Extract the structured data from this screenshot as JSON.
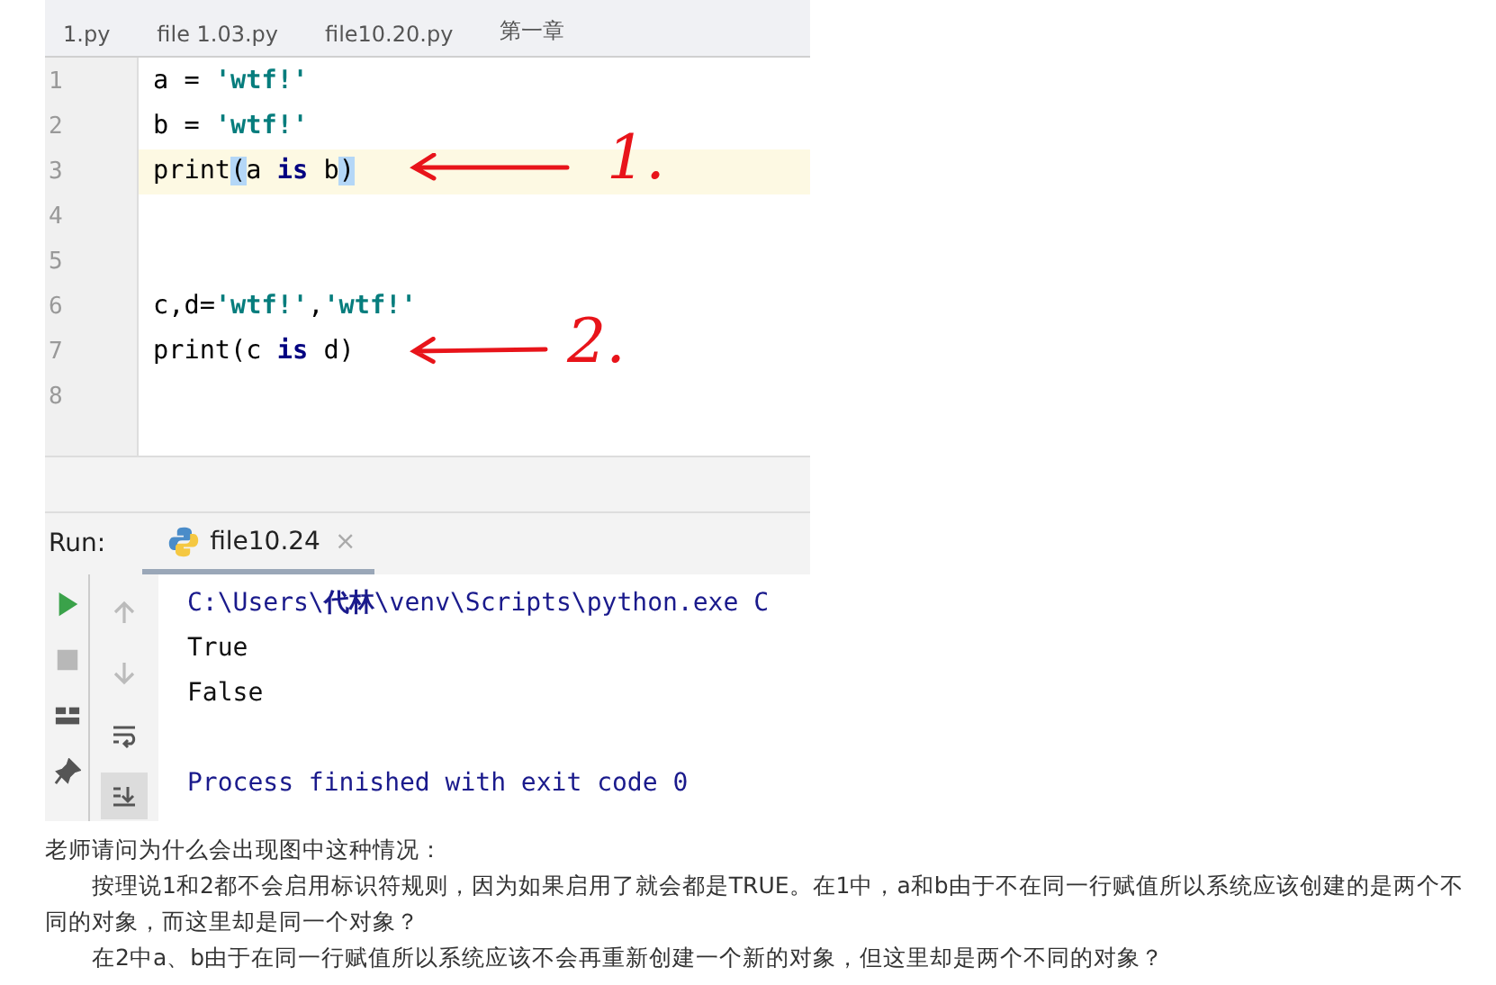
{
  "editor": {
    "tabs": [
      {
        "label": "1.py",
        "selected": false
      },
      {
        "label": "file 1.03.py",
        "selected": false
      },
      {
        "label": "file10.20.py",
        "selected": false
      },
      {
        "label": "第一章",
        "selected": false
      }
    ],
    "lines": [
      {
        "number": "1",
        "current": false,
        "tokens": [
          {
            "kind": "plain",
            "text": "a = "
          },
          {
            "kind": "string",
            "text": "'wtf!'"
          }
        ]
      },
      {
        "number": "2",
        "current": false,
        "tokens": [
          {
            "kind": "plain",
            "text": "b = "
          },
          {
            "kind": "string",
            "text": "'wtf!'"
          }
        ]
      },
      {
        "number": "3",
        "current": true,
        "tokens": [
          {
            "kind": "plain",
            "text": "print"
          },
          {
            "kind": "brace",
            "text": "("
          },
          {
            "kind": "plain",
            "text": "a "
          },
          {
            "kind": "keyword",
            "text": "is"
          },
          {
            "kind": "plain",
            "text": " b"
          },
          {
            "kind": "brace",
            "text": ")"
          }
        ]
      },
      {
        "number": "4",
        "current": false
      },
      {
        "number": "5",
        "current": false
      },
      {
        "number": "6",
        "current": false,
        "tokens": [
          {
            "kind": "plain",
            "text": "c,d="
          },
          {
            "kind": "string",
            "text": "'wtf!'"
          },
          {
            "kind": "plain",
            "text": ","
          },
          {
            "kind": "string",
            "text": "'wtf!'"
          }
        ]
      },
      {
        "number": "7",
        "current": false,
        "tokens": [
          {
            "kind": "plain",
            "text": "print(c "
          },
          {
            "kind": "keyword",
            "text": "is"
          },
          {
            "kind": "plain",
            "text": " d)"
          }
        ]
      },
      {
        "number": "8",
        "current": false
      }
    ],
    "annotations": [
      {
        "text": "1."
      },
      {
        "text": "2."
      }
    ]
  },
  "run": {
    "label": "Run:",
    "tab": {
      "label": "file10.24",
      "close": "×"
    },
    "toolbar": [
      {
        "disabled": true,
        "on": false
      },
      {
        "disabled": true,
        "on": false
      },
      {
        "disabled": false,
        "on": false
      },
      {
        "disabled": false,
        "on": true
      }
    ],
    "output": [
      {
        "kind": "command",
        "text": "C:\\Users\\**代林**\\venv\\Scripts\\python.exe C"
      },
      {
        "kind": "plain",
        "text": "True"
      },
      {
        "kind": "plain",
        "text": "False"
      },
      {
        "kind": "blank"
      },
      {
        "kind": "status",
        "text": "Process finished with exit code 0"
      }
    ]
  },
  "question": {
    "title": "老师请问为什么会出现图中这种情况：",
    "paragraphs": [
      "按理说1和2都不会启用标识符规则，因为如果启用了就会都是TRUE。在1中，a和b由于不在同一行赋值所以系统应该创建的是两个不同的对象，而这里却是同一个对象？",
      "在2中a、b由于在同一行赋值所以系统应该不会再重新创建一个新的对象，但这里却是两个不同的对象？"
    ]
  }
}
